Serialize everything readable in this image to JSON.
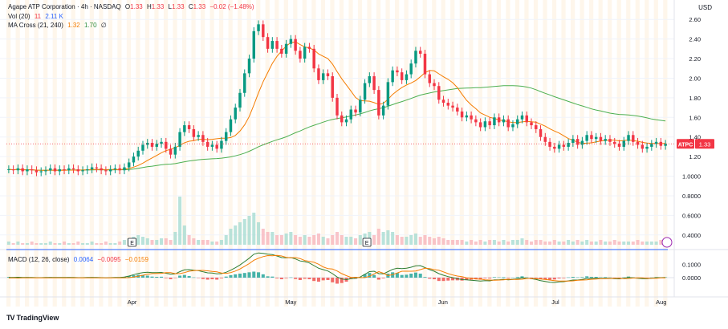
{
  "header": {
    "title": "Agape ATP Corporation · 4h · NASDAQ",
    "o_label": "O",
    "o_value": "1.33",
    "h_label": "H",
    "h_value": "1.33",
    "l_label": "L",
    "l_value": "1.33",
    "c_label": "C",
    "c_value": "1.33",
    "change": "−0.02 (−1.48%)"
  },
  "vol_legend": {
    "label": "Vol (20)",
    "value1": "11",
    "value2": "2.11 K"
  },
  "ma_legend": {
    "label": "MA Cross (21, 240)",
    "value1": "1.32",
    "value2": "1.70",
    "suffix": "∅"
  },
  "macd_legend": {
    "label": "MACD (12, 26, close)",
    "value1": "0.0064",
    "value2": "−0.0095",
    "value3": "−0.0159"
  },
  "currency": "USD",
  "price_tag": {
    "symbol": "ATPC",
    "value": "1.33"
  },
  "brand": {
    "mark": "TV",
    "text": "TradingView"
  },
  "events": [
    "E",
    "E"
  ],
  "colors": {
    "up": "#089981",
    "down": "#f23645",
    "ma_fast": "#f57c00",
    "ma_slow": "#4caf50",
    "macd": "#2e7d32",
    "signal": "#f57c00",
    "accent": "#2962ff"
  },
  "chart_data": {
    "type": "candlestick",
    "price_axis": {
      "ticks": [
        "2.60",
        "2.40",
        "2.20",
        "2.00",
        "1.80",
        "1.60",
        "1.40",
        "1.20",
        "1.0000",
        "0.8000",
        "0.6000",
        "0.4000"
      ],
      "values": [
        2.6,
        2.4,
        2.2,
        2.0,
        1.8,
        1.6,
        1.4,
        1.2,
        1.0,
        0.8,
        0.6,
        0.4
      ],
      "ylim": [
        0.3,
        2.7
      ]
    },
    "macd_axis": {
      "ticks": [
        "0.1000",
        "0.0000"
      ],
      "values": [
        0.1,
        0.0
      ],
      "ylim": [
        -0.12,
        0.18
      ]
    },
    "x_axis": {
      "labels": [
        "Apr",
        "May",
        "Jun",
        "Jul",
        "Aug"
      ]
    },
    "close": [
      1.07,
      1.06,
      1.08,
      1.05,
      1.07,
      1.06,
      1.04,
      1.05,
      1.06,
      1.08,
      1.05,
      1.07,
      1.06,
      1.08,
      1.07,
      1.05,
      1.06,
      1.07,
      1.09,
      1.08,
      1.06,
      1.05,
      1.07,
      1.08,
      1.06,
      1.09,
      1.14,
      1.2,
      1.26,
      1.32,
      1.34,
      1.3,
      1.33,
      1.35,
      1.28,
      1.22,
      1.3,
      1.45,
      1.52,
      1.48,
      1.4,
      1.42,
      1.35,
      1.3,
      1.32,
      1.28,
      1.36,
      1.45,
      1.58,
      1.7,
      1.85,
      2.05,
      2.2,
      2.48,
      2.55,
      2.42,
      2.3,
      2.38,
      2.3,
      2.25,
      2.35,
      2.4,
      2.28,
      2.2,
      2.32,
      2.3,
      2.1,
      1.98,
      2.05,
      2.02,
      1.8,
      1.62,
      1.55,
      1.58,
      1.68,
      1.65,
      1.78,
      1.95,
      2.02,
      1.88,
      1.62,
      1.72,
      1.96,
      2.08,
      2.06,
      1.98,
      2.04,
      2.15,
      2.28,
      2.25,
      2.04,
      1.95,
      1.92,
      1.78,
      1.75,
      1.72,
      1.7,
      1.66,
      1.6,
      1.62,
      1.58,
      1.55,
      1.5,
      1.56,
      1.52,
      1.6,
      1.55,
      1.58,
      1.5,
      1.53,
      1.58,
      1.62,
      1.55,
      1.52,
      1.48,
      1.4,
      1.35,
      1.3,
      1.28,
      1.32,
      1.3,
      1.34,
      1.38,
      1.32,
      1.36,
      1.42,
      1.38,
      1.4,
      1.36,
      1.38,
      1.35,
      1.33,
      1.3,
      1.36,
      1.42,
      1.35,
      1.32,
      1.28,
      1.3,
      1.33,
      1.35,
      1.31,
      1.33
    ],
    "volume": [
      2,
      1,
      2,
      1,
      1,
      2,
      1,
      1,
      1,
      2,
      1,
      1,
      2,
      1,
      1,
      2,
      1,
      1,
      2,
      1,
      1,
      2,
      1,
      1,
      2,
      3,
      4,
      5,
      6,
      5,
      4,
      3,
      3,
      4,
      4,
      3,
      8,
      30,
      12,
      6,
      4,
      3,
      3,
      3,
      2,
      2,
      3,
      6,
      10,
      12,
      14,
      16,
      18,
      20,
      14,
      10,
      8,
      8,
      6,
      6,
      7,
      8,
      6,
      5,
      6,
      5,
      6,
      7,
      5,
      4,
      6,
      8,
      6,
      5,
      5,
      4,
      6,
      7,
      8,
      6,
      10,
      8,
      9,
      8,
      6,
      5,
      5,
      6,
      7,
      5,
      6,
      5,
      4,
      5,
      4,
      3,
      3,
      3,
      3,
      2,
      3,
      2,
      3,
      2,
      3,
      3,
      2,
      3,
      2,
      3,
      3,
      4,
      3,
      2,
      3,
      3,
      2,
      2,
      3,
      2,
      2,
      3,
      2,
      3,
      2,
      3,
      2,
      2,
      3,
      2,
      2,
      3,
      2,
      2,
      2,
      2,
      3,
      2,
      2,
      2,
      2,
      3,
      2,
      2
    ],
    "macd_hist": [
      0.005,
      0.004,
      0.006,
      0.003,
      0.004,
      0.002,
      0.001,
      0.002,
      0.003,
      0.004,
      0.002,
      0.003,
      0.002,
      0.004,
      0.003,
      0.001,
      0.002,
      0.003,
      0.004,
      0.003,
      0.001,
      0.0,
      0.002,
      0.003,
      0.002,
      0.006,
      0.012,
      0.018,
      0.022,
      0.02,
      0.015,
      0.008,
      0.006,
      0.007,
      -0.004,
      -0.012,
      -0.002,
      0.015,
      0.02,
      0.012,
      0.002,
      -0.002,
      -0.01,
      -0.015,
      -0.012,
      -0.015,
      -0.005,
      0.008,
      0.018,
      0.025,
      0.03,
      0.035,
      0.04,
      0.045,
      0.04,
      0.025,
      0.01,
      0.008,
      -0.005,
      -0.012,
      -0.004,
      0.002,
      -0.01,
      -0.018,
      -0.008,
      -0.012,
      -0.025,
      -0.03,
      -0.02,
      -0.018,
      -0.035,
      -0.045,
      -0.04,
      -0.03,
      -0.01,
      -0.008,
      0.005,
      0.025,
      0.035,
      0.02,
      -0.015,
      -0.005,
      0.03,
      0.04,
      0.035,
      0.02,
      0.022,
      0.03,
      0.038,
      0.03,
      0.005,
      -0.008,
      -0.012,
      -0.025,
      -0.025,
      -0.022,
      -0.02,
      -0.02,
      -0.022,
      -0.015,
      -0.015,
      -0.012,
      -0.015,
      -0.005,
      -0.006,
      0.004,
      0.002,
      0.004,
      -0.004,
      0.0,
      0.005,
      0.01,
      0.002,
      -0.002,
      -0.006,
      -0.012,
      -0.014,
      -0.016,
      -0.014,
      -0.006,
      -0.004,
      0.002,
      0.006,
      0.002,
      0.004,
      0.01,
      0.006,
      0.006,
      0.002,
      0.004,
      0.001,
      -0.002,
      -0.004,
      0.002,
      0.008,
      0.002,
      -0.002,
      -0.006,
      -0.004,
      0.001,
      0.004,
      0.002,
      0.003
    ],
    "macd_line": [
      0.002,
      0.002,
      0.003,
      0.002,
      0.002,
      0.001,
      0.0,
      0.0,
      0.001,
      0.002,
      0.001,
      0.001,
      0.001,
      0.002,
      0.002,
      0.0,
      0.0,
      0.001,
      0.002,
      0.002,
      0.0,
      -0.001,
      0.0,
      0.001,
      0.001,
      0.004,
      0.012,
      0.022,
      0.032,
      0.038,
      0.04,
      0.038,
      0.038,
      0.039,
      0.033,
      0.025,
      0.028,
      0.045,
      0.058,
      0.06,
      0.055,
      0.052,
      0.044,
      0.036,
      0.034,
      0.028,
      0.03,
      0.04,
      0.056,
      0.074,
      0.095,
      0.12,
      0.145,
      0.175,
      0.185,
      0.182,
      0.175,
      0.172,
      0.162,
      0.15,
      0.148,
      0.15,
      0.14,
      0.125,
      0.12,
      0.11,
      0.09,
      0.07,
      0.06,
      0.05,
      0.03,
      0.005,
      -0.01,
      -0.015,
      -0.008,
      -0.005,
      0.005,
      0.025,
      0.045,
      0.048,
      0.03,
      0.028,
      0.045,
      0.062,
      0.07,
      0.068,
      0.07,
      0.078,
      0.088,
      0.09,
      0.075,
      0.06,
      0.048,
      0.03,
      0.018,
      0.008,
      0.0,
      -0.008,
      -0.015,
      -0.016,
      -0.02,
      -0.022,
      -0.026,
      -0.022,
      -0.024,
      -0.016,
      -0.016,
      -0.012,
      -0.016,
      -0.014,
      -0.008,
      -0.002,
      -0.004,
      -0.008,
      -0.014,
      -0.022,
      -0.028,
      -0.034,
      -0.036,
      -0.032,
      -0.03,
      -0.024,
      -0.018,
      -0.018,
      -0.014,
      -0.006,
      -0.006,
      -0.004,
      -0.006,
      -0.004,
      -0.005,
      -0.007,
      -0.009,
      -0.005,
      0.002,
      -0.001,
      -0.004,
      -0.008,
      -0.008,
      -0.004,
      0.0,
      0.0,
      0.001
    ]
  }
}
